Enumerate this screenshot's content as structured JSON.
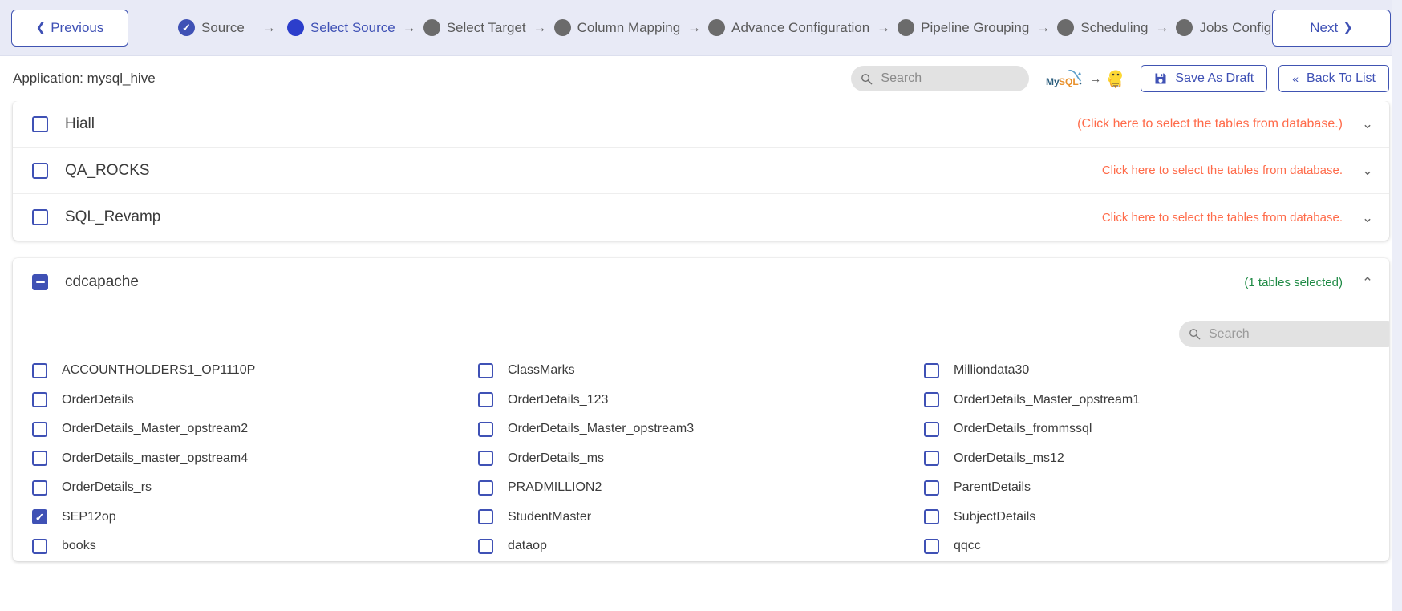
{
  "stepper": {
    "previous_label": "Previous",
    "next_label": "Next",
    "prev_icon": "chevron-left-icon",
    "next_icon": "chevron-right-icon",
    "arrow_glyph": "→",
    "check_glyph": "✓",
    "steps": [
      {
        "label": "Source",
        "state": "done"
      },
      {
        "label": "Select Source",
        "state": "active"
      },
      {
        "label": "Select Target",
        "state": "pending"
      },
      {
        "label": "Column Mapping",
        "state": "pending"
      },
      {
        "label": "Advance Configuration",
        "state": "pending"
      },
      {
        "label": "Pipeline Grouping",
        "state": "pending"
      },
      {
        "label": "Scheduling",
        "state": "pending"
      },
      {
        "label": "Jobs Configuration",
        "state": "pending"
      }
    ]
  },
  "appbar": {
    "title": "Application: mysql_hive",
    "search": {
      "value": "",
      "placeholder": "Search",
      "icon": "search-icon"
    },
    "source_logo": "mysql-logo",
    "source_logo_text": "MySQL",
    "target_logo": "apache-hive-logo",
    "logo_arrow": "→",
    "save_draft_label": "Save As Draft",
    "save_draft_icon": "save-floppy-icon",
    "back_to_list_label": "Back To List",
    "back_to_list_icon": "double-chevron-left-icon"
  },
  "databases": [
    {
      "name": "Hiall",
      "checked": false,
      "hint": "(Click here to select the tables from database.)",
      "hint_paren": true,
      "expanded": false,
      "caret": "⌄"
    },
    {
      "name": "QA_ROCKS",
      "checked": false,
      "hint": "Click here to select the tables from database.",
      "hint_paren": false,
      "expanded": false,
      "caret": "⌄"
    },
    {
      "name": "SQL_Revamp",
      "checked": false,
      "hint": "Click here to select the tables from database.",
      "hint_paren": false,
      "expanded": false,
      "caret": "⌄"
    }
  ],
  "expanded_db": {
    "name": "cdcapache",
    "checkbox_state": "indeterminate",
    "selected_label": "(1 tables selected)",
    "caret": "⌃",
    "search": {
      "value": "",
      "placeholder": "Search",
      "icon": "search-icon"
    },
    "tables": [
      {
        "name": "ACCOUNTHOLDERS1_OP1110P",
        "checked": false
      },
      {
        "name": "ClassMarks",
        "checked": false
      },
      {
        "name": "Milliondata30",
        "checked": false
      },
      {
        "name": "OrderDetails",
        "checked": false
      },
      {
        "name": "OrderDetails_123",
        "checked": false
      },
      {
        "name": "OrderDetails_Master_opstream1",
        "checked": false
      },
      {
        "name": "OrderDetails_Master_opstream2",
        "checked": false
      },
      {
        "name": "OrderDetails_Master_opstream3",
        "checked": false
      },
      {
        "name": "OrderDetails_frommssql",
        "checked": false
      },
      {
        "name": "OrderDetails_master_opstream4",
        "checked": false
      },
      {
        "name": "OrderDetails_ms",
        "checked": false
      },
      {
        "name": "OrderDetails_ms12",
        "checked": false
      },
      {
        "name": "OrderDetails_rs",
        "checked": false
      },
      {
        "name": "PRADMILLION2",
        "checked": false
      },
      {
        "name": "ParentDetails",
        "checked": false
      },
      {
        "name": "SEP12op",
        "checked": true
      },
      {
        "name": "StudentMaster",
        "checked": false
      },
      {
        "name": "SubjectDetails",
        "checked": false
      },
      {
        "name": "books",
        "checked": false
      },
      {
        "name": "dataop",
        "checked": false
      },
      {
        "name": "qqcc",
        "checked": false
      }
    ]
  },
  "colors": {
    "primary": "#3f51b5",
    "hint": "#ff6b4a",
    "success": "#1f8a45",
    "stepper_bg": "#e8eaf6",
    "pending_dot": "#6b6b6b"
  }
}
